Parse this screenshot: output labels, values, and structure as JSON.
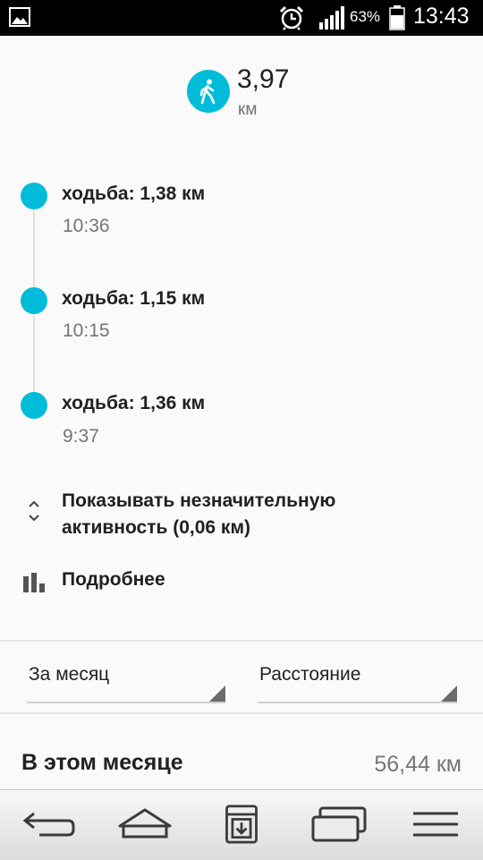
{
  "status_bar": {
    "battery_percent": "63%",
    "time": "13:43",
    "icons": [
      "gallery-icon",
      "alarm-icon",
      "signal-icon",
      "battery-icon"
    ]
  },
  "summary": {
    "activity_icon": "walking-icon",
    "value": "3,97",
    "unit": "км",
    "accent_color": "#00bcd9"
  },
  "timeline": [
    {
      "title": "ходьба: 1,38 км",
      "time": "10:36"
    },
    {
      "title": "ходьба: 1,15 км",
      "time": "10:15"
    },
    {
      "title": "ходьба: 1,36 км",
      "time": "9:37"
    }
  ],
  "actions": {
    "show_minor": "Показывать незначительную активность (0,06 км)",
    "details": "Подробнее"
  },
  "filters": {
    "period": "За месяц",
    "metric": "Расстояние"
  },
  "month_total": {
    "label": "В этом месяце",
    "value": "56,44 км"
  },
  "nav": [
    "back-icon",
    "home-icon",
    "download-icon",
    "recent-apps-icon",
    "menu-icon"
  ]
}
